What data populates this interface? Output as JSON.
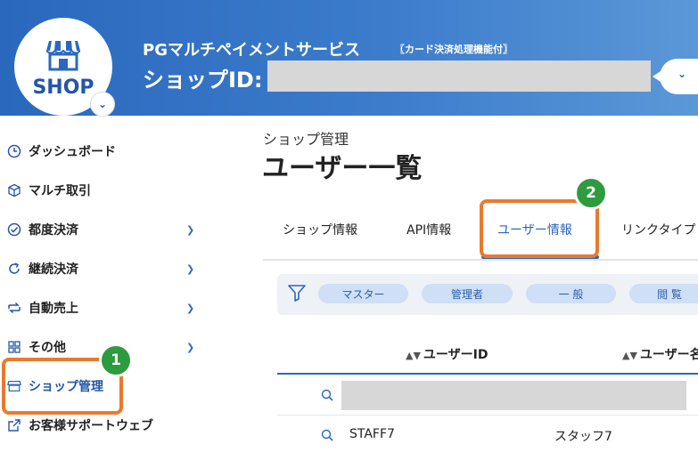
{
  "header": {
    "logo_text": "SHOP",
    "brand": "PGマルチペイメントサービス",
    "brand_sub": "〖カード決済処理機能付〗",
    "shop_id_label": "ショップID:",
    "shop_id_value": ""
  },
  "sidebar": {
    "items": [
      {
        "label": "ダッシュボード",
        "icon": "clock-icon",
        "expandable": false
      },
      {
        "label": "マルチ取引",
        "icon": "cube-icon",
        "expandable": false
      },
      {
        "label": "都度決済",
        "icon": "check-circle-icon",
        "expandable": true
      },
      {
        "label": "継続決済",
        "icon": "refresh-icon",
        "expandable": true
      },
      {
        "label": "自動売上",
        "icon": "swap-icon",
        "expandable": true
      },
      {
        "label": "その他",
        "icon": "grid-icon",
        "expandable": true
      },
      {
        "label": "ショップ管理",
        "icon": "store-icon",
        "expandable": false,
        "active": true
      },
      {
        "label": "お客様サポートウェブ",
        "icon": "external-link-icon",
        "expandable": false
      }
    ]
  },
  "callouts": {
    "one": "1",
    "two": "2"
  },
  "main": {
    "breadcrumb": "ショップ管理",
    "title": "ユーザー一覧",
    "tabs": [
      {
        "label": "ショップ情報"
      },
      {
        "label": "API情報"
      },
      {
        "label": "ユーザー情報",
        "active": true
      },
      {
        "label": "リンクタイプ"
      }
    ],
    "filter_chips": [
      "マスター",
      "管理者",
      "一 般",
      "閲 覧"
    ],
    "table": {
      "columns": [
        "ユーザーID",
        "ユーザー名"
      ],
      "rows": [
        {
          "user_id": "",
          "user_name": ""
        },
        {
          "user_id": "STAFF7",
          "user_name": "スタッフ7"
        }
      ]
    }
  },
  "colors": {
    "header_blue": "#2a68bd",
    "accent_blue": "#2456a8",
    "callout_orange": "#e87a2e",
    "badge_green": "#2d9b3e",
    "masked_gray": "#d7d7d7"
  }
}
